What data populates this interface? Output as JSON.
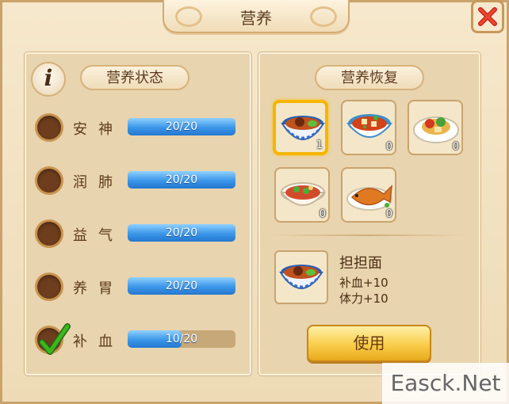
{
  "window": {
    "title": "营养"
  },
  "status_panel": {
    "title": "营养状态",
    "stats": [
      {
        "name": "安神",
        "value": 20,
        "max": 20,
        "label": "20/20",
        "checked": false
      },
      {
        "name": "润肺",
        "value": 20,
        "max": 20,
        "label": "20/20",
        "checked": false
      },
      {
        "name": "益气",
        "value": 20,
        "max": 20,
        "label": "20/20",
        "checked": false
      },
      {
        "name": "养胃",
        "value": 20,
        "max": 20,
        "label": "20/20",
        "checked": false
      },
      {
        "name": "补血",
        "value": 10,
        "max": 20,
        "label": "10/20",
        "checked": true
      }
    ]
  },
  "recovery_panel": {
    "title": "营养恢复",
    "items": [
      {
        "icon": "dandan-noodle-bowl-icon",
        "count": "1",
        "selected": true
      },
      {
        "icon": "mapo-tofu-bowl-icon",
        "count": "0",
        "selected": false
      },
      {
        "icon": "stir-fry-plate-icon",
        "count": "0",
        "selected": false
      },
      {
        "icon": "pepper-stew-bowl-icon",
        "count": "0",
        "selected": false
      },
      {
        "icon": "braised-fish-icon",
        "count": "0",
        "selected": false
      }
    ],
    "detail": {
      "name": "担担面",
      "effects": [
        "补血+10",
        "体力+10"
      ]
    },
    "use_label": "使用"
  },
  "watermark": "Easck.Net",
  "colors": {
    "bar_blue": "#3b96e8",
    "check_green": "#3fb51f",
    "selected_border": "#f5b500",
    "button_gold": "#f8cd4a"
  }
}
